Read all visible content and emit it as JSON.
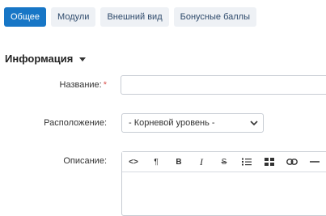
{
  "tabs": [
    {
      "label": "Общее",
      "active": true
    },
    {
      "label": "Модули",
      "active": false
    },
    {
      "label": "Внешний вид",
      "active": false
    },
    {
      "label": "Бонусные баллы",
      "active": false
    }
  ],
  "section": {
    "title": "Информация"
  },
  "form": {
    "name_label": "Название:",
    "name_required": "*",
    "name_value": "",
    "location_label": "Расположение:",
    "location_selected": "- Корневой уровень -",
    "description_label": "Описание:"
  },
  "toolbar": {
    "code_label": "<>",
    "paragraph_label": "¶",
    "bold_label": "B",
    "italic_label": "I",
    "strike_label": "S"
  },
  "colors": {
    "accent": "#1776c6",
    "tab_bg": "#eef1f5",
    "required": "#d9534f"
  }
}
